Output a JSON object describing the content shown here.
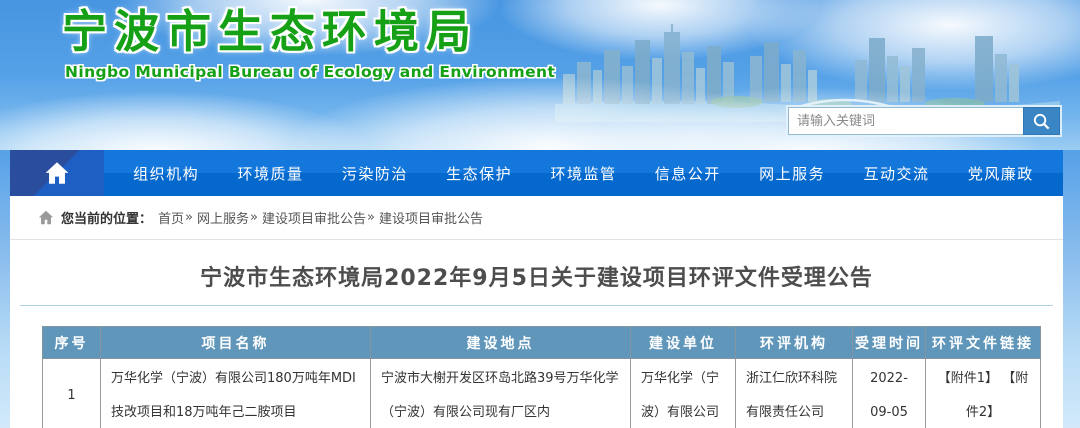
{
  "header": {
    "site_title": "宁波市生态环境局",
    "site_subtitle": "Ningbo Municipal Bureau of Ecology and Environment",
    "search": {
      "placeholder": "请输入关键词"
    }
  },
  "nav": {
    "items": [
      "组织机构",
      "环境质量",
      "污染防治",
      "生态保护",
      "环境监管",
      "信息公开",
      "网上服务",
      "互动交流",
      "党风廉政"
    ]
  },
  "breadcrumb": {
    "label": "您当前的位置：",
    "separator": "»",
    "links": [
      "首页",
      "网上服务",
      "建设项目审批公告",
      "建设项目审批公告"
    ]
  },
  "page": {
    "title": "宁波市生态环境局2022年9月5日关于建设项目环评文件受理公告"
  },
  "table": {
    "headers": [
      "序号",
      "项目名称",
      "建设地点",
      "建设单位",
      "环评机构",
      "受理时间",
      "环评文件链接"
    ],
    "rows": [
      {
        "seq": "1",
        "project_name": "万华化学（宁波）有限公司180万吨年MDI技改项目和18万吨年己二胺项目",
        "location": "宁波市大榭开发区环岛北路39号万华化学（宁波）有限公司现有厂区内",
        "builder": "万华化学（宁波）有限公司",
        "eia_agency": "浙江仁欣环科院有限责任公司",
        "accept_date": "2022-09-05",
        "attachments": [
          "【附件1】",
          "【附件2】"
        ]
      }
    ]
  },
  "colors": {
    "brand_green": "#16a016",
    "nav_blue_top": "#1377dc",
    "nav_blue_bottom": "#0568cd",
    "home_tab_dark": "#2b4d9d",
    "table_header_bg": "#6096ba",
    "search_button_blue": "#3a86c4",
    "divider_blue": "#aed3ea"
  }
}
